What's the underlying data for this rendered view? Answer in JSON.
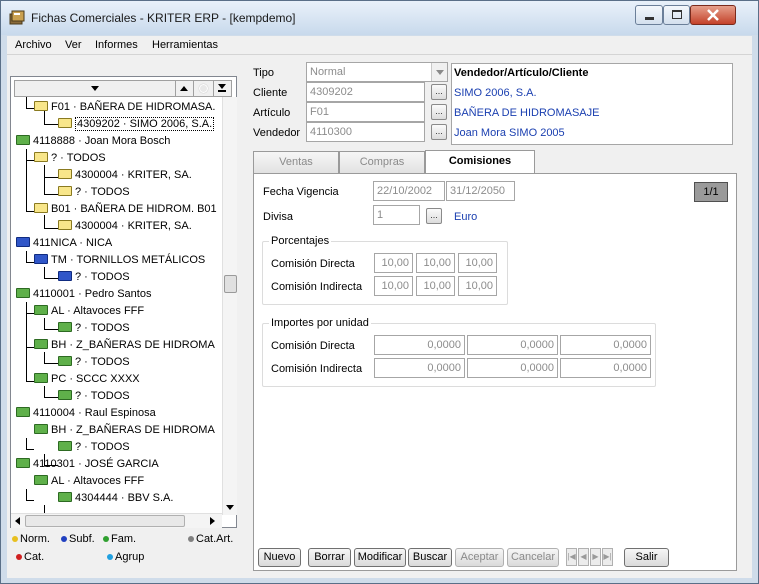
{
  "window": {
    "title": "Fichas Comerciales - KRITER ERP - [kempdemo]"
  },
  "menu": {
    "items": [
      "Archivo",
      "Ver",
      "Informes",
      "Herramientas"
    ]
  },
  "tree": {
    "nodes": [
      {
        "text": "F01 · BAÑERA DE HIDROMASA.",
        "color": "yellow"
      },
      {
        "text": "4309202 · SIMO 2006, S.A.",
        "color": "yellow",
        "selected": true
      },
      {
        "text": "4118888 · Joan Mora Bosch",
        "color": "green"
      },
      {
        "text": "? · TODOS",
        "color": "yellow"
      },
      {
        "text": "4300004 · KRITER, SA.",
        "color": "yellow"
      },
      {
        "text": "? · TODOS",
        "color": "yellow"
      },
      {
        "text": "B01 · BAÑERA DE HIDROM. B01",
        "color": "yellow"
      },
      {
        "text": "4300004 · KRITER, SA.",
        "color": "yellow"
      },
      {
        "text": "411NICA · NICA",
        "color": "blue"
      },
      {
        "text": "TM · TORNILLOS METÁLICOS",
        "color": "blue"
      },
      {
        "text": "? · TODOS",
        "color": "blue"
      },
      {
        "text": "4110001 · Pedro Santos",
        "color": "green"
      },
      {
        "text": "AL · Altavoces  FFF",
        "color": "green"
      },
      {
        "text": "? · TODOS",
        "color": "green"
      },
      {
        "text": "BH · Z_BAÑERAS DE HIDROMA",
        "color": "green"
      },
      {
        "text": "? · TODOS",
        "color": "green"
      },
      {
        "text": "PC · SCCC XXXX",
        "color": "green"
      },
      {
        "text": "? · TODOS",
        "color": "green"
      },
      {
        "text": "4110004 · Raul Espinosa",
        "color": "green"
      },
      {
        "text": "BH · Z_BAÑERAS DE HIDROMA",
        "color": "green"
      },
      {
        "text": "? · TODOS",
        "color": "green"
      },
      {
        "text": "4110301 · JOSÉ GARCIA",
        "color": "green"
      },
      {
        "text": "AL · Altavoces  FFF",
        "color": "green"
      },
      {
        "text": "4304444 · BBV S.A.",
        "color": "green"
      }
    ]
  },
  "legend": {
    "norm": "Norm.",
    "subf": "Subf.",
    "fam": "Fam.",
    "catart": "Cat.Art.",
    "cat": "Cat.",
    "agrup": "Agrup",
    "colors": {
      "norm": "#e8c020",
      "subf": "#2040c0",
      "fam": "#30a030",
      "catart": "#808080",
      "cat": "#d02020",
      "agrup": "#20a0e0"
    }
  },
  "header_form": {
    "tipo_label": "Tipo",
    "tipo_value": "Normal",
    "cliente_label": "Cliente",
    "cliente_value": "4309202",
    "articulo_label": "Artículo",
    "articulo_value": "F01",
    "vendedor_label": "Vendedor",
    "vendedor_value": "4110300",
    "info_title": "Vendedor/Artículo/Cliente",
    "info_cliente": "SIMO 2006, S.A.",
    "info_articulo": "BAÑERA DE HIDROMASAJE",
    "info_vendedor": "Joan Mora SIMO 2005"
  },
  "tabs": [
    "Ventas",
    "Compras",
    "Comisiones"
  ],
  "comisiones": {
    "fecha_label": "Fecha Vigencia",
    "fecha_desde": "22/10/2002",
    "fecha_hasta": "31/12/2050",
    "page_indicator": "1/1",
    "divisa_label": "Divisa",
    "divisa_value": "1",
    "divisa_name": "Euro",
    "porcentajes": {
      "title": "Porcentajes",
      "directa_label": "Comisión Directa",
      "directa_values": [
        "10,00",
        "10,00",
        "10,00"
      ],
      "indirecta_label": "Comisión Indirecta",
      "indirecta_values": [
        "10,00",
        "10,00",
        "10,00"
      ]
    },
    "importes": {
      "title": "Importes por unidad",
      "directa_label": "Comisión Directa",
      "directa_values": [
        "0,0000",
        "0,0000",
        "0,0000"
      ],
      "indirecta_label": "Comisión Indirecta",
      "indirecta_values": [
        "0,0000",
        "0,0000",
        "0,0000"
      ]
    }
  },
  "buttons": {
    "nuevo": "Nuevo",
    "borrar": "Borrar",
    "modificar": "Modificar",
    "buscar": "Buscar",
    "aceptar": "Aceptar",
    "cancelar": "Cancelar",
    "salir": "Salir"
  }
}
